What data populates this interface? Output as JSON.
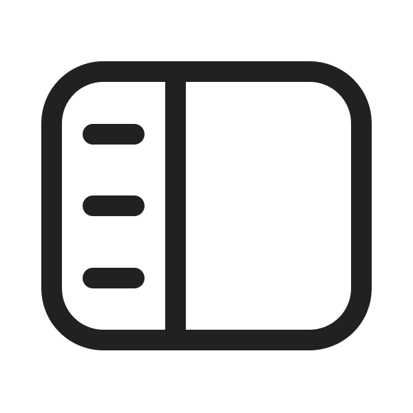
{
  "icon": {
    "name": "sidebar-layout-icon",
    "stroke_color": "#212121",
    "background_color": "#ffffff",
    "parts": {
      "outer_frame": "rounded-rectangle",
      "divider": "vertical-line",
      "menu_lines": [
        "menu-line-1",
        "menu-line-2",
        "menu-line-3"
      ]
    }
  }
}
